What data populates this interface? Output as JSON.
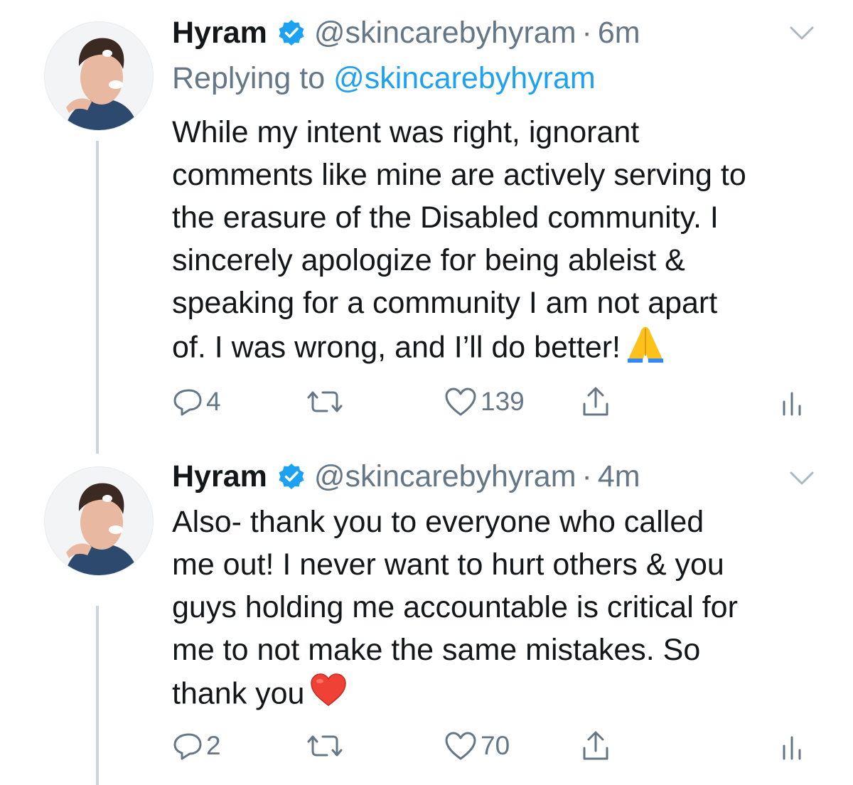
{
  "tweets": [
    {
      "name": "Hyram",
      "handle": "@skincarebyhyram",
      "separator": "·",
      "time": "6m",
      "replying_label": "Replying to ",
      "replying_handle": "@skincarebyhyram",
      "text": "While my intent was right, ignorant\ncomments like mine are actively serving to\nthe erasure of the Disabled community. I\nsincerely apologize for being ableist &\nspeaking for a community I am not apart\nof. I was wrong, and I’ll do better!",
      "emoji": "folded-hands-emoji",
      "replies": "4",
      "likes": "139"
    },
    {
      "name": "Hyram",
      "handle": "@skincarebyhyram",
      "separator": "·",
      "time": "4m",
      "text": "Also- thank you to everyone who called\nme out! I never want to hurt others & you\nguys holding me accountable is critical for\nme to not make the same mistakes. So\nthank you",
      "emoji": "red-heart-emoji",
      "replies": "2",
      "likes": "70"
    }
  ],
  "colors": {
    "text": "#14171a",
    "secondary": "#657786",
    "link": "#1da1f2",
    "verified": "#1da1f2",
    "thread_line": "#ccd6dd"
  },
  "icons": [
    "verified-badge-icon",
    "chevron-down-icon",
    "reply-icon",
    "retweet-icon",
    "like-icon",
    "share-icon",
    "analytics-icon"
  ]
}
